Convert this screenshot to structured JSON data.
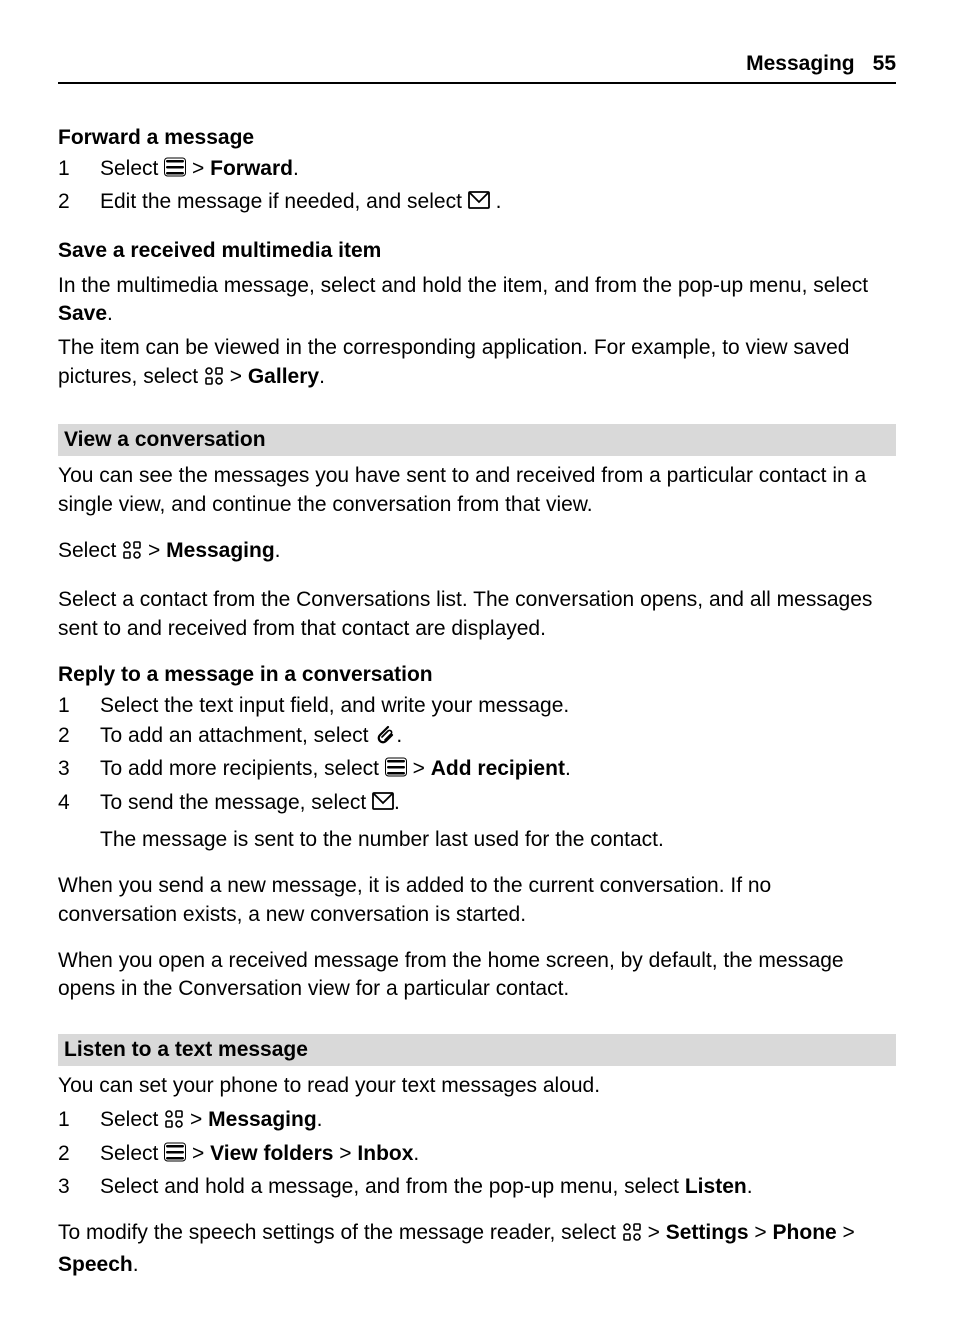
{
  "header": {
    "title": "Messaging",
    "page": "55"
  },
  "sec1": {
    "heading": "Forward a message",
    "step1a": "Select ",
    "step1b": " > ",
    "step1c": "Forward",
    "step1d": ".",
    "step2a": "Edit the message if needed, and select ",
    "step2b": " ."
  },
  "sec2": {
    "heading": "Save a received multimedia item",
    "p1a": "In the multimedia message, select and hold the item, and from the pop-up menu, select ",
    "p1b": "Save",
    "p1c": ".",
    "p2a": "The item can be viewed in the corresponding application. For example, to view saved pictures, select ",
    "p2b": " > ",
    "p2c": "Gallery",
    "p2d": "."
  },
  "sec3": {
    "heading": "View a conversation",
    "p1": "You can see the messages you have sent to and received from a particular contact in a single view, and continue the conversation from that view.",
    "p2a": "Select ",
    "p2b": " > ",
    "p2c": "Messaging",
    "p2d": ".",
    "p3": "Select a contact from the Conversations list. The conversation opens, and all messages sent to and received from that contact are displayed."
  },
  "sec4": {
    "heading": "Reply to a message in a conversation",
    "s1": "Select the text input field, and write your message.",
    "s2a": "To add an attachment, select ",
    "s2b": ".",
    "s3a": "To add more recipients, select ",
    "s3b": " > ",
    "s3c": "Add recipient",
    "s3d": ".",
    "s4a": "To send the message, select ",
    "s4b": ".",
    "s4note": "The message is sent to the number last used for the contact.",
    "p1": "When you send a new message, it is added to the current conversation. If no conversation exists, a new conversation is started.",
    "p2": "When you open a received message from the home screen, by default, the message opens in the Conversation view for a particular contact."
  },
  "sec5": {
    "heading": "Listen to a text message",
    "p1": "You can set your phone to read your text messages aloud.",
    "s1a": "Select ",
    "s1b": " > ",
    "s1c": "Messaging",
    "s1d": ".",
    "s2a": "Select ",
    "s2b": " > ",
    "s2c": "View folders",
    "s2d": " > ",
    "s2e": "Inbox",
    "s2f": ".",
    "s3a": "Select and hold a message, and from the pop-up menu, select ",
    "s3b": "Listen",
    "s3c": ".",
    "p2a": "To modify the speech settings of the message reader, select ",
    "p2b": " > ",
    "p2c": "Settings",
    "p2d": " > ",
    "p2e": "Phone",
    "p2f": " > ",
    "p2g": "Speech",
    "p2h": "."
  }
}
